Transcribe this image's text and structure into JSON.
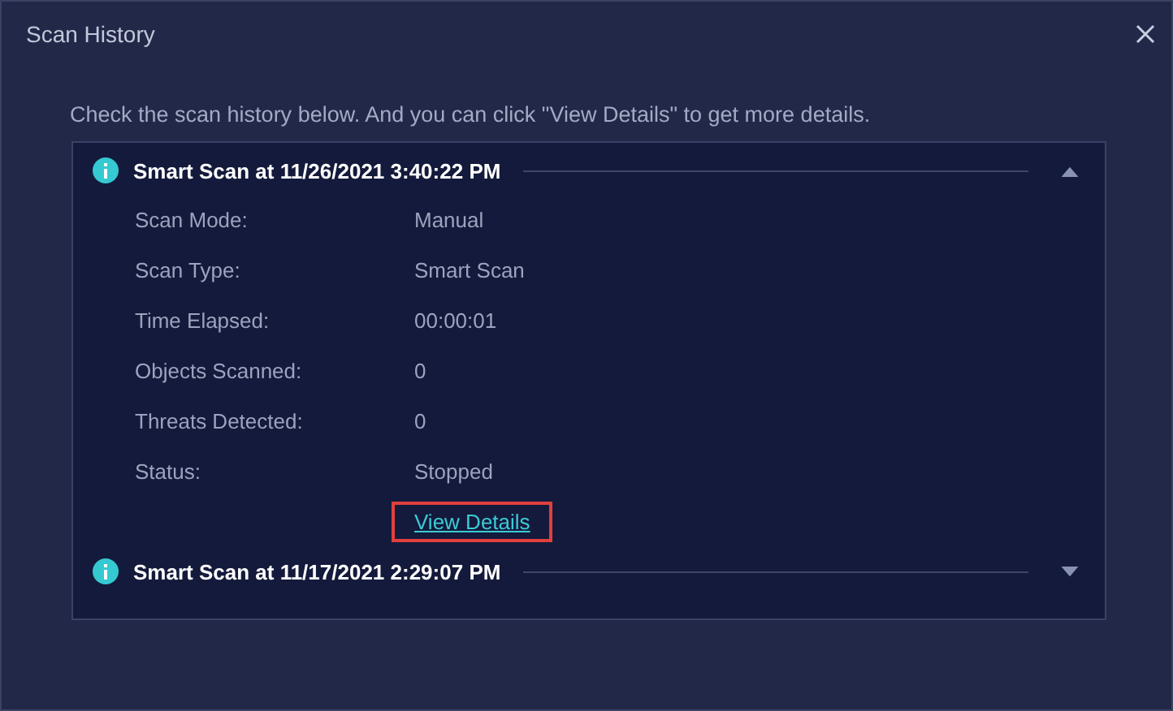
{
  "window": {
    "title": "Scan History"
  },
  "intro": "Check the scan history below. And you can click \"View Details\" to get more details.",
  "scans": [
    {
      "title": "Smart Scan at 11/26/2021 3:40:22 PM",
      "expanded": true,
      "details": [
        {
          "label": "Scan Mode:",
          "value": "Manual"
        },
        {
          "label": "Scan Type:",
          "value": "Smart Scan"
        },
        {
          "label": "Time Elapsed:",
          "value": "00:00:01"
        },
        {
          "label": "Objects Scanned:",
          "value": "0"
        },
        {
          "label": "Threats Detected:",
          "value": "0"
        },
        {
          "label": "Status:",
          "value": "Stopped"
        }
      ],
      "link": {
        "label": "View Details",
        "highlighted": true
      }
    },
    {
      "title": "Smart Scan at 11/17/2021 2:29:07 PM",
      "expanded": false
    }
  ]
}
